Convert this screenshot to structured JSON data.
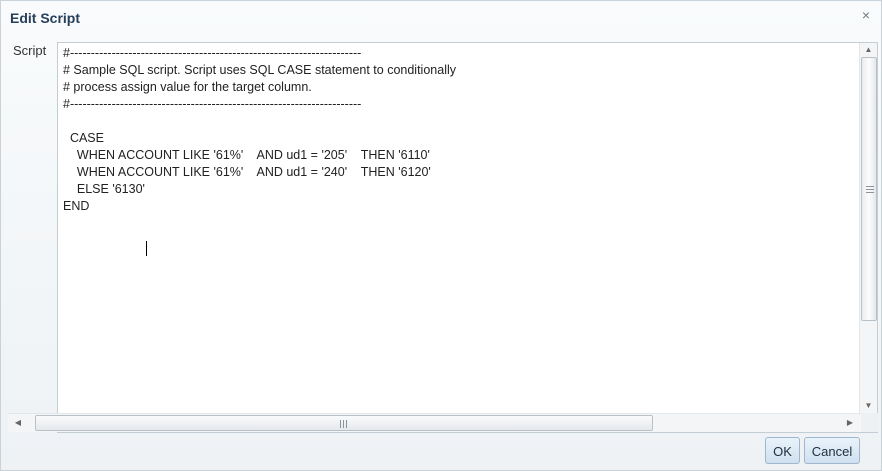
{
  "dialog": {
    "title": "Edit Script",
    "close_glyph": "×",
    "script_label": "Script"
  },
  "editor": {
    "lines": [
      "#----------------------------------------------------------------------",
      "# Sample SQL script. Script uses SQL CASE statement to conditionally",
      "# process assign value for the target column.",
      "#----------------------------------------------------------------------",
      "",
      "  CASE",
      "    WHEN ACCOUNT LIKE '61%'    AND ud1 = '205'    THEN '6110'",
      "    WHEN ACCOUNT LIKE '61%'    AND ud1 = '240'    THEN '6120'",
      "    ELSE '6130'",
      "END"
    ]
  },
  "scrollbars": {
    "up_arrow": "▲",
    "down_arrow": "▼",
    "left_arrow": "◀",
    "right_arrow": "▶"
  },
  "buttons": {
    "ok_label": "OK",
    "cancel_label": "Cancel"
  },
  "icons": {
    "close": "close-icon"
  }
}
